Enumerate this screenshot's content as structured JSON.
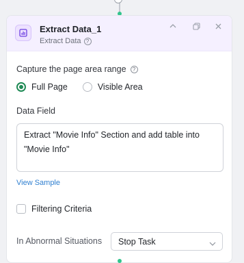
{
  "node": {
    "title": "Extract Data_1",
    "subtitle": "Extract Data",
    "icon": "bar-chart-icon",
    "accent_color": "#7c3aed"
  },
  "capture": {
    "label": "Capture the page area range",
    "options": [
      {
        "label": "Full Page",
        "selected": true
      },
      {
        "label": "Visible Area",
        "selected": false
      }
    ]
  },
  "data_field": {
    "label": "Data Field",
    "value": "Extract \"Movie Info\" Section and add table into \"Movie Info\""
  },
  "view_sample": "View Sample",
  "filtering": {
    "label": "Filtering Criteria",
    "checked": false
  },
  "abnormal": {
    "label": "In Abnormal Situations",
    "selected": "Stop Task"
  }
}
